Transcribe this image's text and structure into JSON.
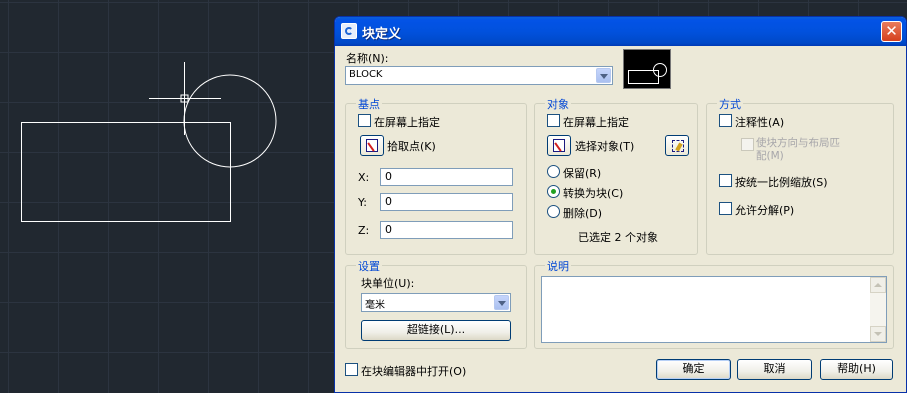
{
  "dialog": {
    "title": "块定义",
    "close": "✕",
    "name_label": "名称(N):",
    "name_value": "BLOCK",
    "open_in_editor": "在块编辑器中打开(O)"
  },
  "base_point": {
    "title": "基点",
    "specify_on_screen": "在屏幕上指定",
    "pick_point": "拾取点(K)",
    "x_label": "X:",
    "x_value": "0",
    "y_label": "Y:",
    "y_value": "0",
    "z_label": "Z:",
    "z_value": "0"
  },
  "objects": {
    "title": "对象",
    "specify_on_screen": "在屏幕上指定",
    "select_objects": "选择对象(T)",
    "retain": "保留(R)",
    "convert": "转换为块(C)",
    "delete": "删除(D)",
    "selected_count": "已选定 2 个对象"
  },
  "behavior": {
    "title": "方式",
    "annotative": "注释性(A)",
    "match_orientation": "使块方向与布局匹配(M)",
    "scale_uniformly": "按统一比例缩放(S)",
    "allow_exploding": "允许分解(P)"
  },
  "settings": {
    "title": "设置",
    "block_unit_label": "块单位(U):",
    "block_unit_value": "毫米",
    "hyperlink": "超链接(L)..."
  },
  "description": {
    "title": "说明"
  },
  "buttons": {
    "ok": "确定",
    "cancel": "取消",
    "help": "帮助(H)"
  },
  "colors": {
    "canvas_bg": "#212830",
    "grid": "#2c3440",
    "drawing": "#ffffff",
    "dialog_bg": "#ece9d8",
    "titlebar": "#0151dd",
    "group_title": "#0046d5"
  }
}
